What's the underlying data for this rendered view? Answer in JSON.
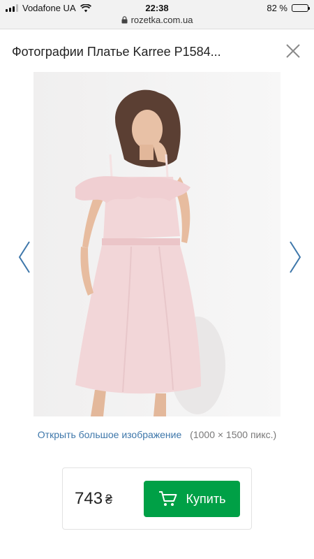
{
  "status_bar": {
    "carrier": "Vodafone UA",
    "time": "22:38",
    "battery": "82 %",
    "battery_level": 0.82
  },
  "url_bar": {
    "domain": "rozetka.com.ua"
  },
  "header": {
    "title": "Фотографии Платье Karree P1584...",
    "close_icon": "close-icon"
  },
  "gallery": {
    "prev_icon": "chevron-left-icon",
    "next_icon": "chevron-right-icon",
    "open_large_label": "Открыть большое изображение",
    "dimensions": "(1000 × 1500 пикс.)"
  },
  "buy": {
    "price": "743",
    "currency": "₴",
    "button_label": "Купить",
    "button_icon": "cart-icon"
  },
  "colors": {
    "link": "#3e77aa",
    "buy_button": "#00a046",
    "dress": "#f2d6d8"
  }
}
